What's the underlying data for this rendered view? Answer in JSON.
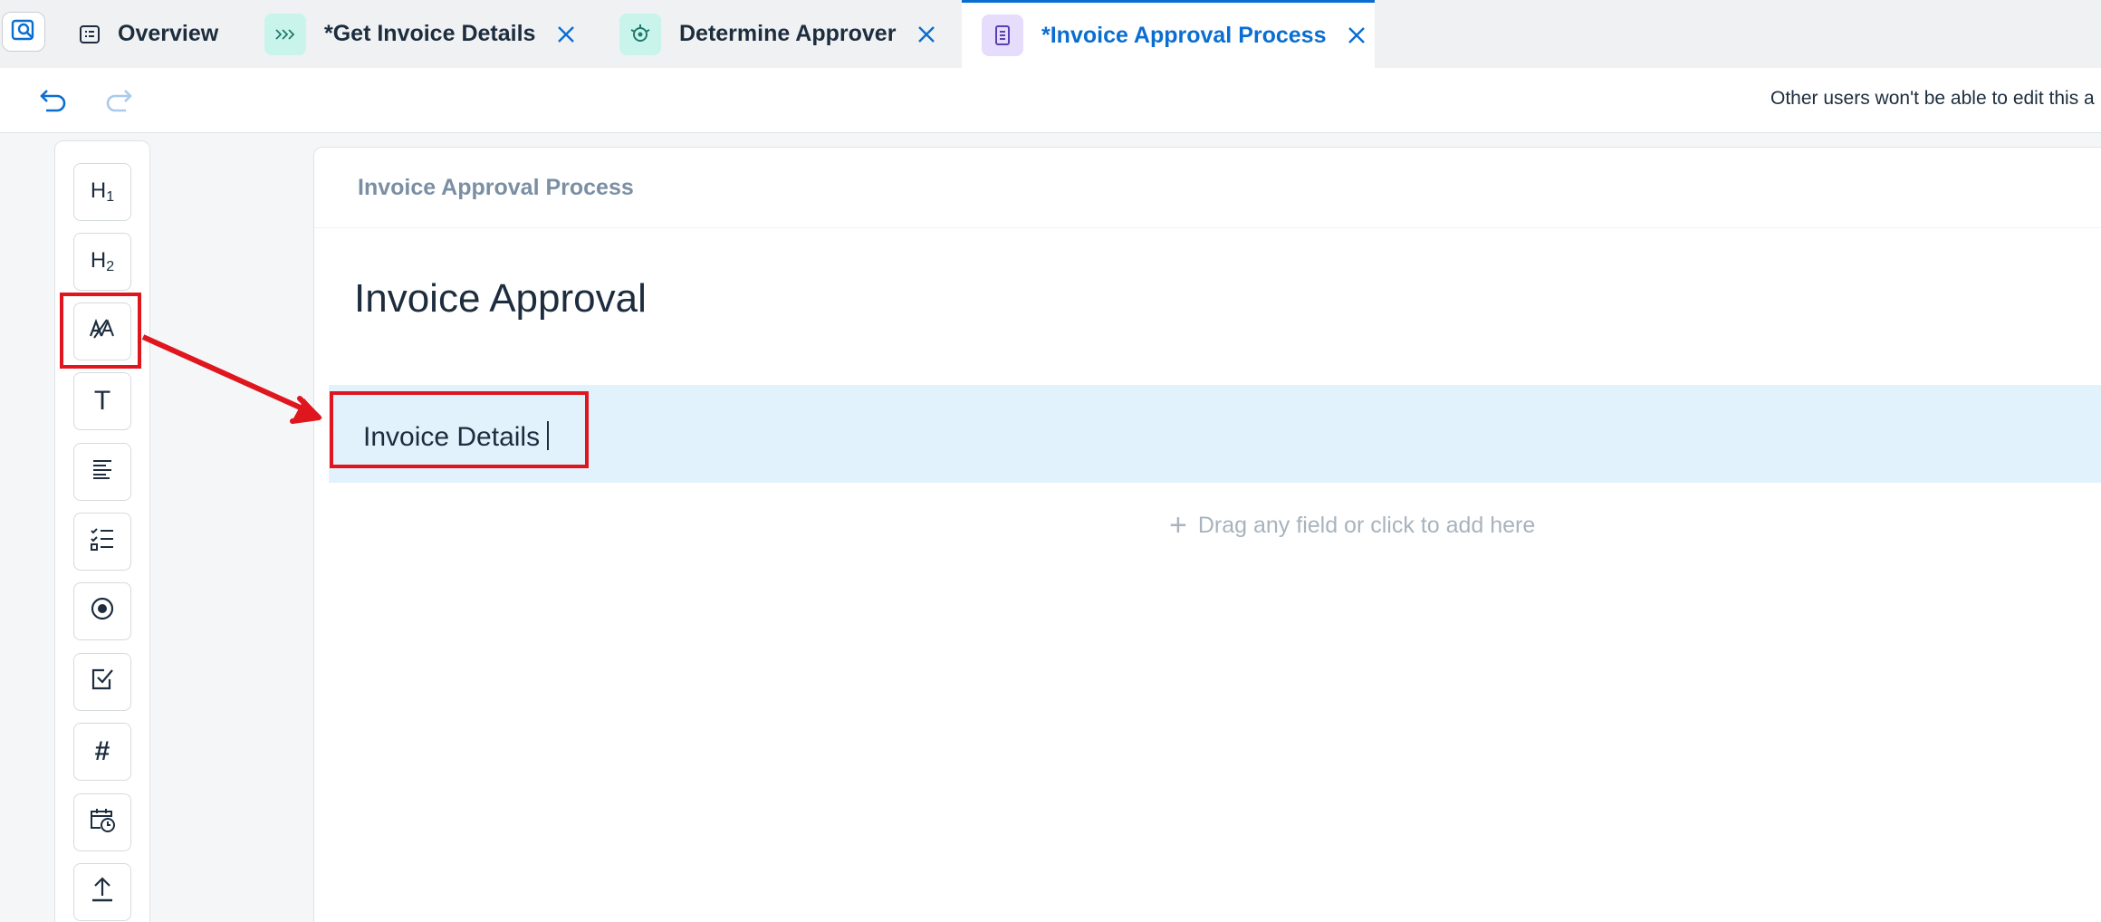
{
  "tabs": [
    {
      "label": "Overview",
      "icon": "document-list-icon",
      "closable": false,
      "active": false
    },
    {
      "label": "*Get Invoice Details",
      "icon": "chevrons-right-icon",
      "closable": true,
      "active": false,
      "icon_bg": "#c9f4ec"
    },
    {
      "label": "Determine Approver",
      "icon": "decision-icon",
      "closable": true,
      "active": false,
      "icon_bg": "#c9f4ec"
    },
    {
      "label": "*Invoice Approval Process",
      "icon": "form-icon",
      "closable": true,
      "active": true,
      "icon_bg": "#e6dcfb"
    }
  ],
  "toolbar": {
    "undo_icon": "undo-icon",
    "redo_icon": "redo-icon",
    "lock_message": "Other users won't be able to edit this a"
  },
  "palette": {
    "items": [
      {
        "name": "heading-1",
        "label": "H",
        "sub": "1"
      },
      {
        "name": "heading-2",
        "label": "H",
        "sub": "2"
      },
      {
        "name": "section-header",
        "icon": "section-text-icon"
      },
      {
        "name": "text",
        "label": "T"
      },
      {
        "name": "paragraph",
        "icon": "paragraph-icon"
      },
      {
        "name": "checklist",
        "icon": "checklist-icon"
      },
      {
        "name": "radio",
        "icon": "radio-icon"
      },
      {
        "name": "checkbox",
        "icon": "checkbox-icon"
      },
      {
        "name": "number",
        "label": "#"
      },
      {
        "name": "date-time",
        "icon": "calendar-clock-icon"
      },
      {
        "name": "upload",
        "icon": "upload-icon"
      }
    ]
  },
  "canvas": {
    "breadcrumb": "Invoice Approval Process",
    "form_title": "Invoice Approval",
    "section_text": "Invoice Details",
    "drop_hint": "Drag any field or click to add here"
  },
  "colors": {
    "accent": "#0a6ed1",
    "highlight": "#e0161f",
    "section_bg": "#e1f2fd"
  }
}
